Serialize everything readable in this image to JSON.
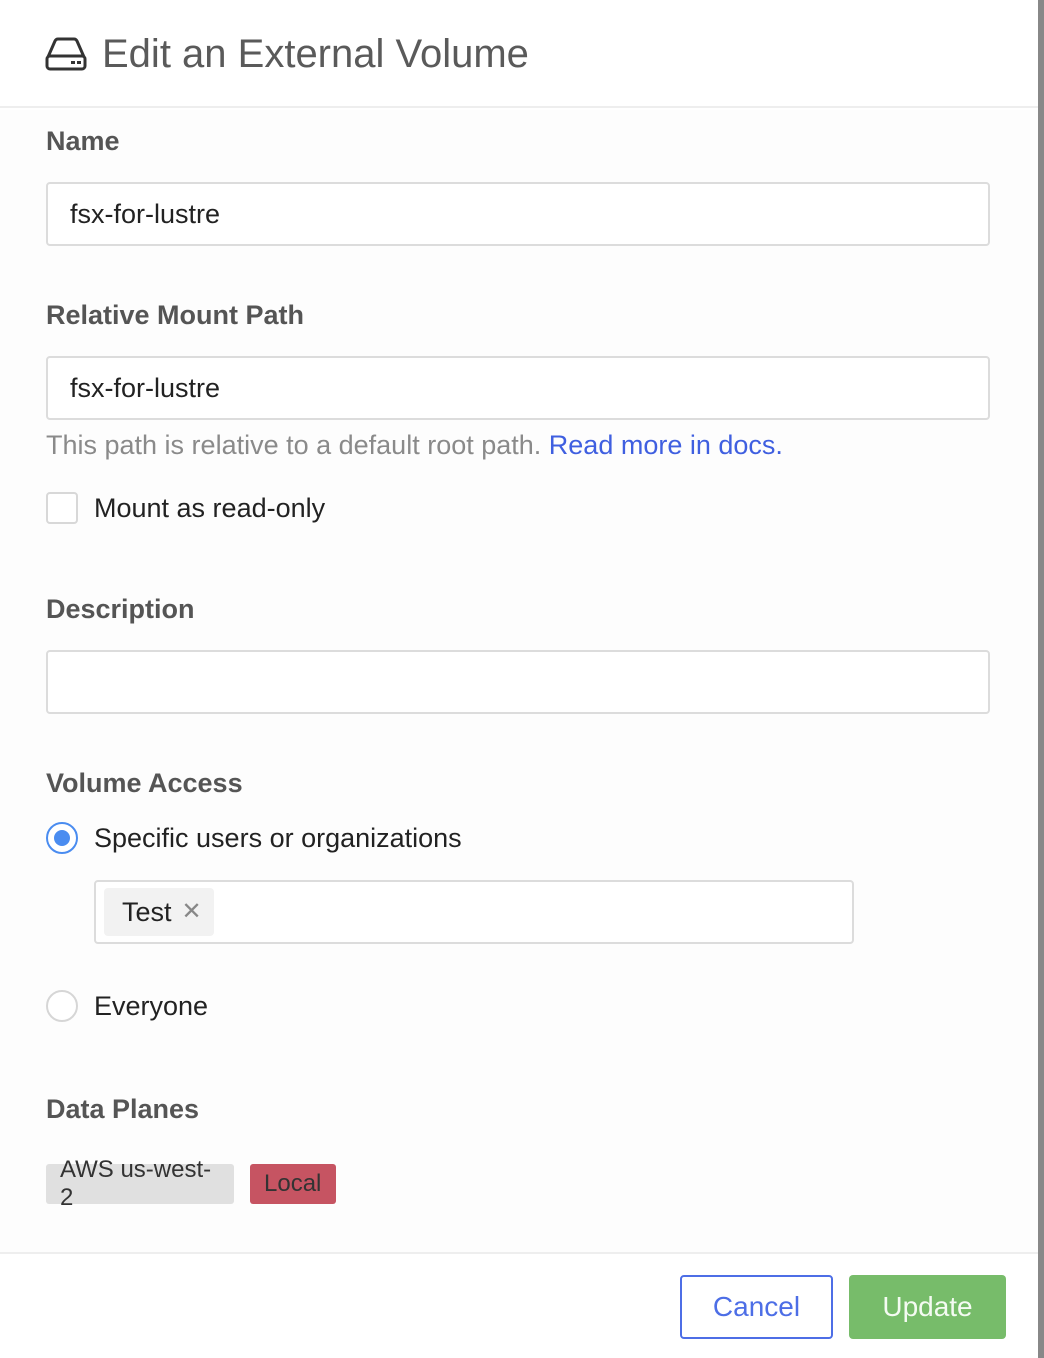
{
  "dialog": {
    "title": "Edit an External Volume",
    "title_icon": "hard-drive-icon"
  },
  "form": {
    "name": {
      "label": "Name",
      "value": "fsx-for-lustre"
    },
    "mount_path": {
      "label": "Relative Mount Path",
      "value": "fsx-for-lustre",
      "hint": "This path is relative to a default root path.",
      "hint_link": "Read more in docs."
    },
    "read_only": {
      "label": "Mount as read-only",
      "checked": false
    },
    "description": {
      "label": "Description",
      "value": ""
    },
    "volume_access": {
      "label": "Volume Access",
      "options": [
        {
          "label": "Specific users or organizations",
          "selected": true
        },
        {
          "label": "Everyone",
          "selected": false
        }
      ],
      "selected_entities": [
        {
          "label": "Test",
          "remove_icon": "close-icon"
        }
      ]
    },
    "data_planes": {
      "label": "Data Planes",
      "items": [
        {
          "label": "AWS us-west-2",
          "color": "#e0e0e0"
        },
        {
          "label": "Local",
          "color": "#c65462"
        }
      ]
    }
  },
  "footer": {
    "cancel_label": "Cancel",
    "update_label": "Update"
  },
  "colors": {
    "link": "#3f5fe0",
    "radio_selected": "#4a8cf0",
    "cancel": "#4d6ee6",
    "update": "#77bc6a"
  }
}
